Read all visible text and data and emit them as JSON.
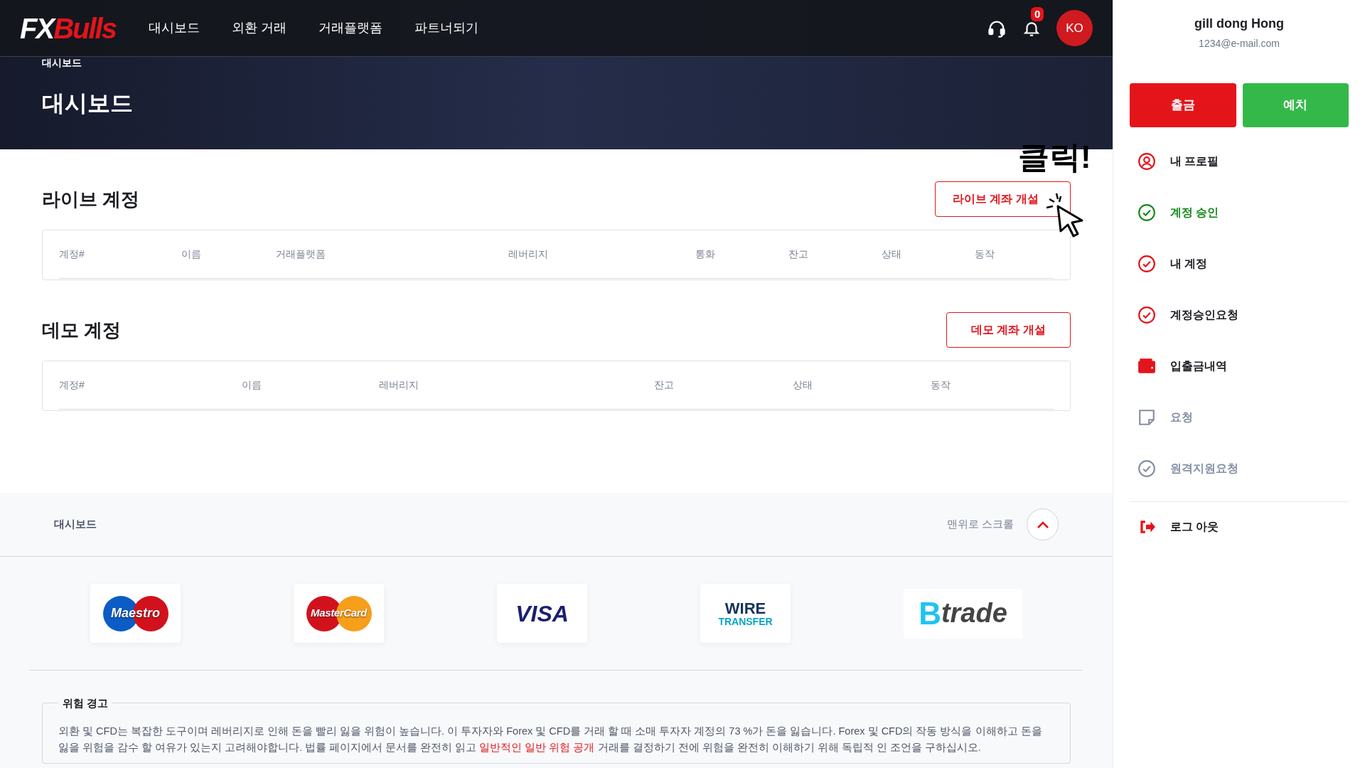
{
  "logo": {
    "prefix": "FX",
    "name": "Bulls"
  },
  "nav": [
    "대시보드",
    "외환 거래",
    "거래플랫폼",
    "파트너되기"
  ],
  "notifications": {
    "count": "0"
  },
  "language": "KO",
  "hero": {
    "breadcrumb": "대시보드",
    "title": "대시보드"
  },
  "annotation": {
    "text": "클릭!"
  },
  "live": {
    "title": "라이브 계정",
    "button": "라이브 계좌 개설",
    "columns": [
      "계정#",
      "이름",
      "거래플랫폼",
      "레버리지",
      "통화",
      "잔고",
      "상태",
      "동작"
    ]
  },
  "demo": {
    "title": "데모 계정",
    "button": "데모 계좌 개설",
    "columns": [
      "계정#",
      "이름",
      "레버리지",
      "잔고",
      "상태",
      "동작"
    ]
  },
  "footer_bar": {
    "breadcrumb": "대시보드",
    "scroll_top": "맨위로 스크롤"
  },
  "payments": [
    {
      "kind": "maestro",
      "label": "Maestro"
    },
    {
      "kind": "mastercard",
      "label": "MasterCard"
    },
    {
      "kind": "visa",
      "label": "VISA"
    },
    {
      "kind": "wire",
      "label": "WIRE",
      "sub": "TRANSFER"
    },
    {
      "kind": "btrade",
      "label": "B",
      "sub": "trade"
    }
  ],
  "risk": {
    "title": "위험 경고",
    "text_before": "외환 및 CFD는 복잡한 도구이며 레버리지로 인해 돈을 빨리 잃을 위험이 높습니다. 이 투자자와 Forex 및 CFD를 거래 할 때 소매 투자자 계정의 73 %가 돈을 잃습니다. Forex 및 CFD의 작동 방식을 이해하고 돈을 잃을 위험을 감수 할 여유가 있는지 고려해야합니다. 법률 페이지에서 문서를 완전히 읽고",
    "link": "일반적인 일반 위험 공개",
    "text_after": "거래를 결정하기 전에 위험을 완전히 이해하기 위해 독립적 인 조언을 구하십시오."
  },
  "user": {
    "name": "gill dong Hong",
    "email": "1234@e-mail.com"
  },
  "actions": [
    {
      "kind": "withdraw",
      "label": "출금"
    },
    {
      "kind": "deposit",
      "label": "예치"
    }
  ],
  "menu": [
    {
      "kind": "profile",
      "label": "내 프로필",
      "selected": false,
      "disabled": false
    },
    {
      "kind": "check",
      "label": "계정 승인",
      "selected": true,
      "disabled": false
    },
    {
      "kind": "check",
      "label": "내 계정",
      "selected": false,
      "disabled": false
    },
    {
      "kind": "check",
      "label": "계정승인요청",
      "selected": false,
      "disabled": false
    },
    {
      "kind": "wallet",
      "label": "입출금내역",
      "selected": false,
      "disabled": false
    },
    {
      "kind": "note",
      "label": "요청",
      "selected": false,
      "disabled": true
    },
    {
      "kind": "check",
      "label": "원격지원요청",
      "selected": false,
      "disabled": true
    }
  ],
  "logout": "로그 아웃"
}
